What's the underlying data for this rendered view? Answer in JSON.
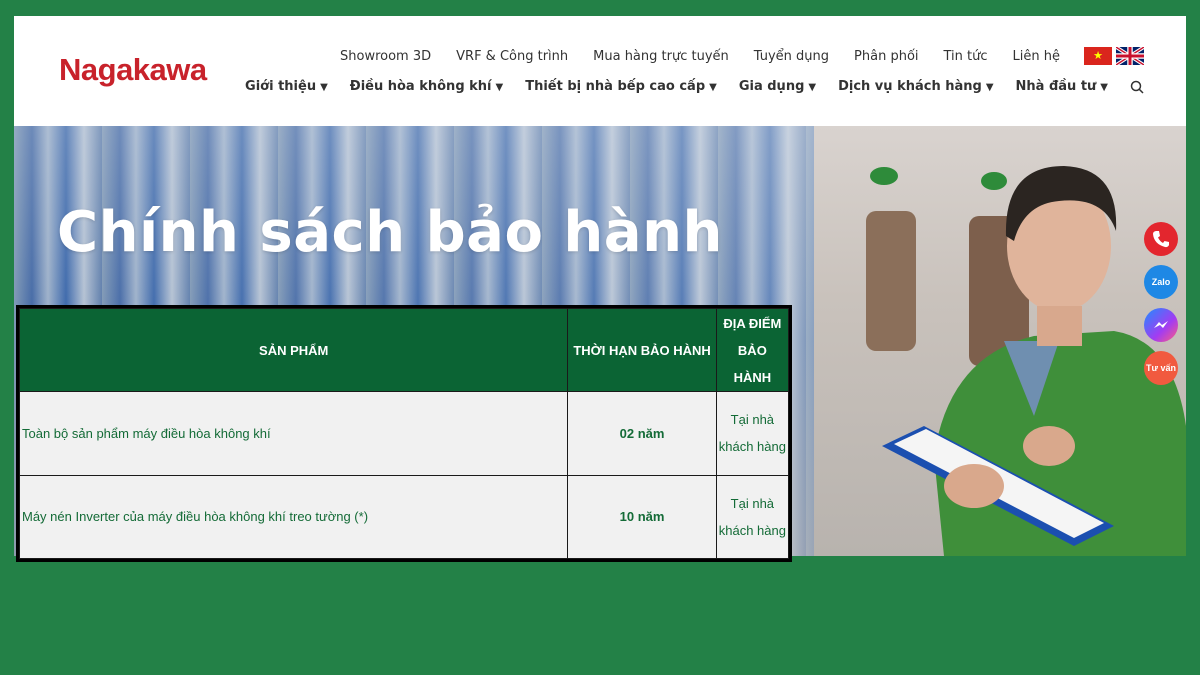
{
  "brand": {
    "name": "Nagakawa"
  },
  "top_nav": [
    "Showroom 3D",
    "VRF & Công trình",
    "Mua hàng trực tuyến",
    "Tuyển dụng",
    "Phân phối",
    "Tin tức",
    "Liên hệ"
  ],
  "main_nav": [
    "Giới thiệu",
    "Điều hòa không khí",
    "Thiết bị nhà bếp cao cấp",
    "Gia dụng",
    "Dịch vụ khách hàng",
    "Nhà đầu tư"
  ],
  "caret": "▼",
  "hero": {
    "title": "Chính sách bảo hành"
  },
  "table": {
    "headers": [
      "SẢN PHẨM",
      "THỜI HẠN BẢO HÀNH",
      "ĐỊA ĐIỂM BẢO HÀNH"
    ],
    "rows": [
      {
        "product": "Toàn bộ sản phẩm máy điều hòa không khí",
        "term": "02 năm",
        "place": "Tại nhà khách hàng"
      },
      {
        "product": "Máy nén Inverter của máy điều hòa không khí treo tường (*)",
        "term": "10 năm",
        "place": "Tại nhà khách hàng"
      }
    ]
  },
  "float_buttons": {
    "zalo": "Zalo",
    "tuvan": "Tư vấn"
  },
  "icons": {
    "search": "search-icon",
    "phone": "phone-icon",
    "zalo": "zalo-icon",
    "messenger": "messenger-icon",
    "flags": [
      "vietnam-flag-icon",
      "uk-flag-icon"
    ]
  },
  "colors": {
    "background": "#238147",
    "brand": "#c8222b",
    "table_header": "#0b6434",
    "table_text": "#146b37"
  }
}
